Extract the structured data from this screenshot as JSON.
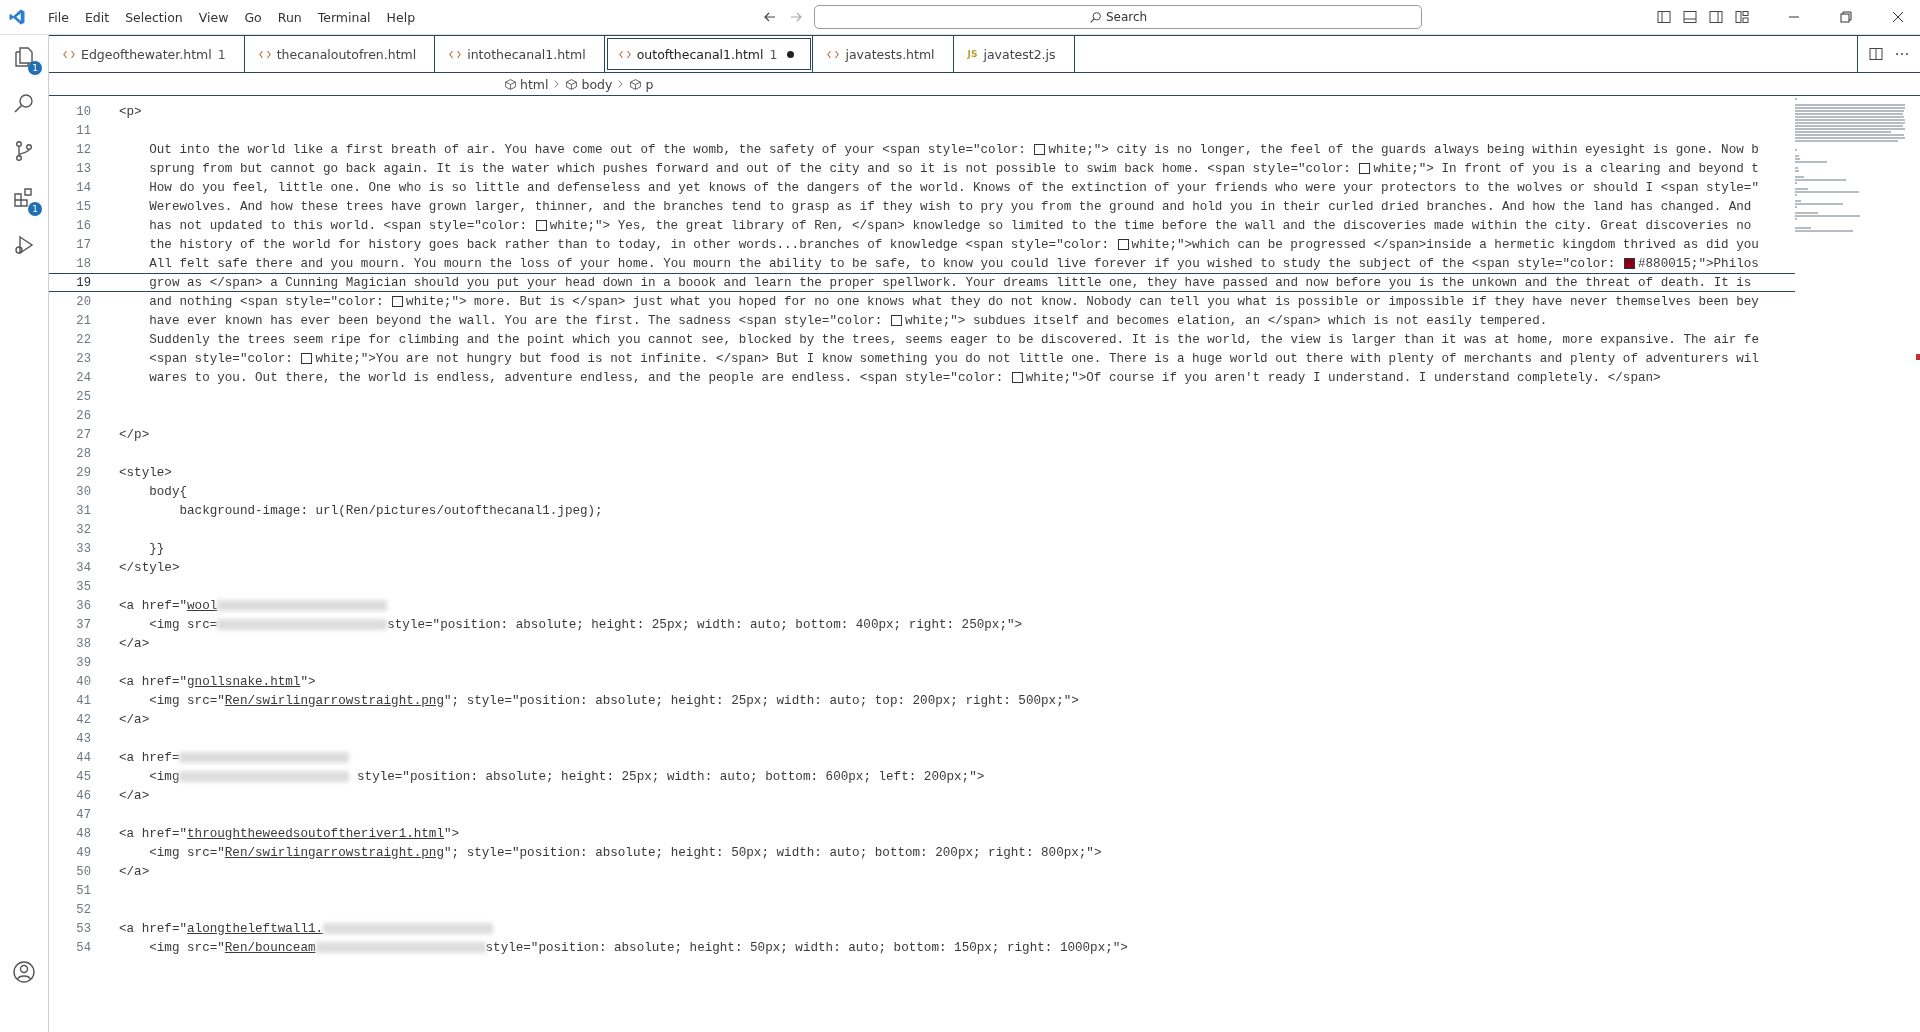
{
  "menu": [
    "File",
    "Edit",
    "Selection",
    "View",
    "Go",
    "Run",
    "Terminal",
    "Help"
  ],
  "search": {
    "placeholder": "Search"
  },
  "activity_bar": [
    {
      "kind": "files",
      "badge": "1"
    },
    {
      "kind": "search"
    },
    {
      "kind": "source-control"
    },
    {
      "kind": "extensions",
      "badge": "1"
    },
    {
      "kind": "run"
    }
  ],
  "tabs": [
    {
      "label": "Edgeofthewater.html",
      "kind": "html",
      "problems": "1",
      "selected": false,
      "modified": false
    },
    {
      "label": "thecanaloutofren.html",
      "kind": "html",
      "selected": false,
      "modified": false
    },
    {
      "label": "intothecanal1.html",
      "kind": "html",
      "selected": false,
      "modified": false
    },
    {
      "label": "outofthecanal1.html",
      "kind": "html",
      "problems": "1",
      "selected": true,
      "modified": true
    },
    {
      "label": "javatests.html",
      "kind": "html",
      "selected": false,
      "modified": false
    },
    {
      "label": "javatest2.js",
      "kind": "js",
      "icon_text": "JS",
      "selected": false,
      "modified": false
    }
  ],
  "breadcrumbs": [
    {
      "label": "html",
      "kind": "element"
    },
    {
      "label": "body",
      "kind": "element"
    },
    {
      "label": "p",
      "kind": "element"
    }
  ],
  "lines": [
    {
      "number": "10",
      "current": false,
      "segments": [
        {
          "kind": "text",
          "text": "<p>"
        }
      ]
    },
    {
      "number": "11",
      "current": false
    },
    {
      "number": "12",
      "current": false,
      "segments": [
        {
          "kind": "text",
          "text": "    Out into the world like a first breath of air. You have come out of the womb, the safety of your <span style=\"color: "
        },
        {
          "kind": "swatch",
          "color": "#ffffff"
        },
        {
          "kind": "text",
          "text": "white;\"> city is no longer, the feel of the guards always being within eyesight is gone. Now b"
        }
      ]
    },
    {
      "number": "13",
      "current": false,
      "segments": [
        {
          "kind": "text",
          "text": "    sprung from but cannot go back again. It is the water which pushes forward and out of the city and so it is not possible to swim back home. <span style=\"color: "
        },
        {
          "kind": "swatch",
          "color": "#ffffff"
        },
        {
          "kind": "text",
          "text": "white;\"> In front of you is a clearing and beyond t"
        }
      ]
    },
    {
      "number": "14",
      "current": false,
      "segments": [
        {
          "kind": "text",
          "text": "    How do you feel, little one. One who is so little and defenseless and yet knows of the dangers of the world. Knows of the extinction of your friends who were your protectors to the wolves or should I <span style=\""
        }
      ]
    },
    {
      "number": "15",
      "current": false,
      "segments": [
        {
          "kind": "text",
          "text": "    Werewolves. And how these trees have grown larger, thinner, and the branches tend to grasp as if they wish to pry you from the ground and hold you in their curled dried branches. And how the land has changed. And"
        }
      ]
    },
    {
      "number": "16",
      "current": false,
      "segments": [
        {
          "kind": "text",
          "text": "    has not updated to this world. <span style=\"color: "
        },
        {
          "kind": "swatch",
          "color": "#ffffff"
        },
        {
          "kind": "text",
          "text": "white;\"> Yes, the great library of Ren, </span> knowledge so limited to the time before the wall and the discoveries made within the city. Great discoveries no"
        }
      ]
    },
    {
      "number": "17",
      "current": false,
      "segments": [
        {
          "kind": "text",
          "text": "    the history of the world for history goes back rather than to today, in other words...branches of knowledge <span style=\"color: "
        },
        {
          "kind": "swatch",
          "color": "#ffffff"
        },
        {
          "kind": "text",
          "text": "white;\">which can be progressed </span>inside a hermetic kingdom thrived as did you"
        }
      ]
    },
    {
      "number": "18",
      "current": false,
      "segments": [
        {
          "kind": "text",
          "text": "    All felt safe there and you mourn. You mourn the loss of your home. You mourn the ability to be safe, to know you could live forever if you wished to study the subject of the <span style=\"color: "
        },
        {
          "kind": "swatch",
          "color": "#880015"
        },
        {
          "kind": "text",
          "text": "#880015;\">Philos"
        }
      ]
    },
    {
      "number": "19",
      "current": true,
      "segments": [
        {
          "kind": "text",
          "text": "    grow as </span> a Cunning Magician should you put your head down in a boook and learn the proper spellwork. Your dreams little one, they have passed and now before you is the unkown and the threat of death. It is"
        }
      ]
    },
    {
      "number": "20",
      "current": false,
      "segments": [
        {
          "kind": "text",
          "text": "    and nothing <span style=\"color: "
        },
        {
          "kind": "swatch",
          "color": "#ffffff"
        },
        {
          "kind": "text",
          "text": "white;\"> more. But is </span> just what you hoped for no one knows what they do not know. Nobody can tell you what is possible or impossible if they have never themselves been bey"
        }
      ]
    },
    {
      "number": "21",
      "current": false,
      "segments": [
        {
          "kind": "text",
          "text": "    have ever known has ever been beyond the wall. You are the first. The sadness <span style=\"color: "
        },
        {
          "kind": "swatch",
          "color": "#ffffff"
        },
        {
          "kind": "text",
          "text": "white;\"> subdues itself and becomes elation, an </span> which is not easily tempered."
        }
      ]
    },
    {
      "number": "22",
      "current": false,
      "segments": [
        {
          "kind": "text",
          "text": "    Suddenly the trees seem ripe for climbing and the point which you cannot see, blocked by the trees, seems eager to be discovered. It is the world, the view is larger than it was at home, more expansive. The air fe"
        }
      ]
    },
    {
      "number": "23",
      "current": false,
      "segments": [
        {
          "kind": "text",
          "text": "    <span style=\"color: "
        },
        {
          "kind": "swatch",
          "color": "#ffffff"
        },
        {
          "kind": "text",
          "text": "white;\">You are not hungry but food is not infinite. </span> But I know something you do not little one. There is a huge world out there with plenty of merchants and plenty of adventurers wil"
        }
      ]
    },
    {
      "number": "24",
      "current": false,
      "segments": [
        {
          "kind": "text",
          "text": "    wares to you. Out there, the world is endless, adventure endless, and the people are endless. <span style=\"color: "
        },
        {
          "kind": "swatch",
          "color": "#ffffff"
        },
        {
          "kind": "text",
          "text": "white;\">Of course if you aren't ready I understand. I understand completely. </span>"
        }
      ]
    },
    {
      "number": "25",
      "current": false
    },
    {
      "number": "26",
      "current": false
    },
    {
      "number": "27",
      "current": false,
      "segments": [
        {
          "kind": "text",
          "text": "</p>"
        }
      ]
    },
    {
      "number": "28",
      "current": false
    },
    {
      "number": "29",
      "current": false,
      "segments": [
        {
          "kind": "text",
          "text": "<style>"
        }
      ]
    },
    {
      "number": "30",
      "current": false,
      "segments": [
        {
          "kind": "text",
          "text": "    body{"
        }
      ]
    },
    {
      "number": "31",
      "current": false,
      "segments": [
        {
          "kind": "text",
          "text": "        background-image: url(Ren/pictures/outofthecanal1.jpeg);"
        }
      ]
    },
    {
      "number": "32",
      "current": false
    },
    {
      "number": "33",
      "current": false,
      "segments": [
        {
          "kind": "text",
          "text": "    }}"
        }
      ]
    },
    {
      "number": "34",
      "current": false,
      "segments": [
        {
          "kind": "text",
          "text": "</style>"
        }
      ]
    },
    {
      "number": "35",
      "current": false
    },
    {
      "number": "36",
      "current": false,
      "segments": [
        {
          "kind": "text",
          "text": "<a href=\""
        },
        {
          "kind": "link",
          "text": "wool"
        },
        {
          "kind": "redacted"
        }
      ]
    },
    {
      "number": "37",
      "current": false,
      "segments": [
        {
          "kind": "text",
          "text": "    <img src="
        },
        {
          "kind": "redacted"
        },
        {
          "kind": "text",
          "text": "style=\"position: absolute; height: 25px; width: auto; bottom: 400px; right: 250px;\">"
        }
      ]
    },
    {
      "number": "38",
      "current": false,
      "segments": [
        {
          "kind": "text",
          "text": "</a>"
        }
      ]
    },
    {
      "number": "39",
      "current": false
    },
    {
      "number": "40",
      "current": false,
      "segments": [
        {
          "kind": "text",
          "text": "<a href=\""
        },
        {
          "kind": "link",
          "text": "gnollsnake.html"
        },
        {
          "kind": "text",
          "text": "\">"
        }
      ]
    },
    {
      "number": "41",
      "current": false,
      "segments": [
        {
          "kind": "text",
          "text": "    <img src=\""
        },
        {
          "kind": "link",
          "text": "Ren/swirlingarrowstraight.png"
        },
        {
          "kind": "text",
          "text": "\"; style=\"position: absolute; height: 25px; width: auto; top: 200px; right: 500px;\">"
        }
      ]
    },
    {
      "number": "42",
      "current": false,
      "segments": [
        {
          "kind": "text",
          "text": "</a>"
        }
      ]
    },
    {
      "number": "43",
      "current": false
    },
    {
      "number": "44",
      "current": false,
      "segments": [
        {
          "kind": "text",
          "text": "<a href="
        },
        {
          "kind": "redacted"
        }
      ]
    },
    {
      "number": "45",
      "current": false,
      "segments": [
        {
          "kind": "text",
          "text": "    <img"
        },
        {
          "kind": "redacted"
        },
        {
          "kind": "text",
          "text": " style=\"position: absolute; height: 25px; width: auto; bottom: 600px; left: 200px;\">"
        }
      ]
    },
    {
      "number": "46",
      "current": false,
      "segments": [
        {
          "kind": "text",
          "text": "</a>"
        }
      ]
    },
    {
      "number": "47",
      "current": false
    },
    {
      "number": "48",
      "current": false,
      "segments": [
        {
          "kind": "text",
          "text": "<a href=\""
        },
        {
          "kind": "link",
          "text": "throughtheweedsoutoftheriver1.html"
        },
        {
          "kind": "text",
          "text": "\">"
        }
      ]
    },
    {
      "number": "49",
      "current": false,
      "segments": [
        {
          "kind": "text",
          "text": "    <img src=\""
        },
        {
          "kind": "link",
          "text": "Ren/swirlingarrowstraight.png"
        },
        {
          "kind": "text",
          "text": "\"; style=\"position: absolute; height: 50px; width: auto; bottom: 200px; right: 800px;\">"
        }
      ]
    },
    {
      "number": "50",
      "current": false,
      "segments": [
        {
          "kind": "text",
          "text": "</a>"
        }
      ]
    },
    {
      "number": "51",
      "current": false
    },
    {
      "number": "52",
      "current": false
    },
    {
      "number": "53",
      "current": false,
      "segments": [
        {
          "kind": "text",
          "text": "<a href=\""
        },
        {
          "kind": "link",
          "text": "alongtheleftwall1."
        },
        {
          "kind": "redacted"
        }
      ]
    },
    {
      "number": "54",
      "current": false,
      "segments": [
        {
          "kind": "text",
          "text": "    <img src=\""
        },
        {
          "kind": "link",
          "text": "Ren/bounceam"
        },
        {
          "kind": "redacted"
        },
        {
          "kind": "text",
          "text": "style=\"position: absolute; height: 50px; width: auto; bottom: 150px; right: 1000px;\">"
        }
      ]
    }
  ]
}
